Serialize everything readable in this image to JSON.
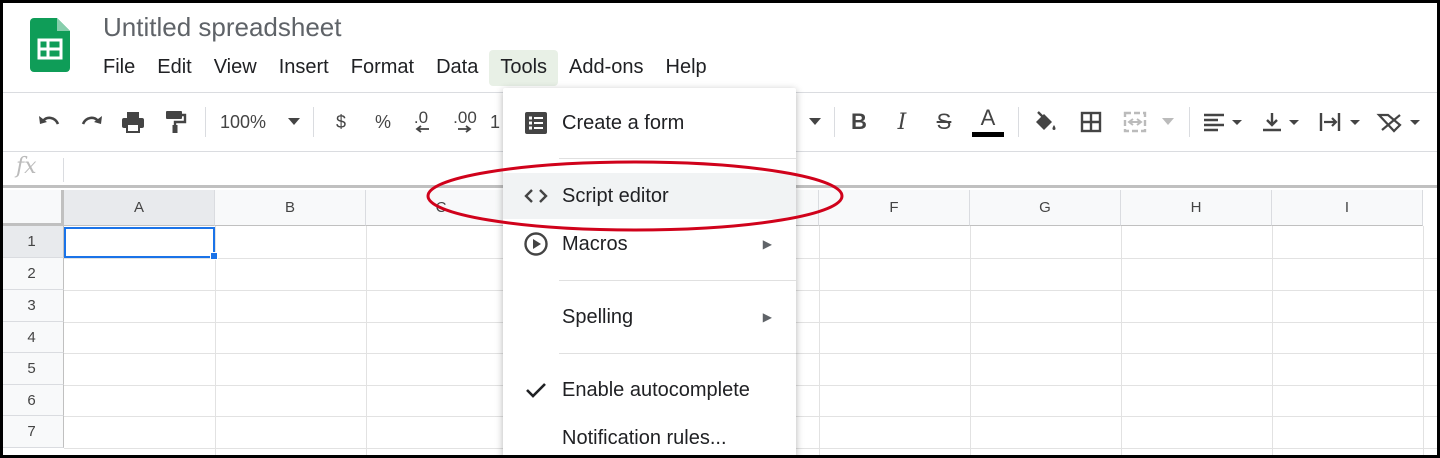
{
  "app": {
    "title": "Untitled spreadsheet",
    "brand_color": "#0f9d58",
    "logo_icon": "sheets-logo-icon"
  },
  "menubar": [
    "File",
    "Edit",
    "View",
    "Insert",
    "Format",
    "Data",
    "Tools",
    "Add-ons",
    "Help"
  ],
  "active_menu": "Tools",
  "toolbar": {
    "zoom": "100%",
    "currency": "$",
    "percent": "%",
    "decrease_decimal": ".0",
    "increase_decimal": ".00",
    "more_formats_partial": "1",
    "bold": "B",
    "italic": "I",
    "strikethrough": "S",
    "text_color": "A",
    "text_color_swatch": "#000000"
  },
  "formula_bar": {
    "fx_label": "fx",
    "value": ""
  },
  "grid": {
    "columns": [
      "A",
      "B",
      "C",
      "",
      "",
      "F",
      "G",
      "H",
      "I"
    ],
    "rows": [
      "1",
      "2",
      "3",
      "4",
      "5",
      "6",
      "7"
    ],
    "selected_cell": "A1",
    "selection_color": "#1a73e8"
  },
  "tools_menu": {
    "items": [
      {
        "label": "Create a form",
        "icon": "form-icon",
        "submenu": false
      },
      {
        "label": "Script editor",
        "icon": "code-icon",
        "submenu": false,
        "hovered": true
      },
      {
        "label": "Macros",
        "icon": "play-circle-icon",
        "submenu": true
      },
      {
        "label": "Spelling",
        "icon": "",
        "submenu": true
      },
      {
        "label": "Enable autocomplete",
        "icon": "checkmark-icon",
        "submenu": false,
        "checked": true
      },
      {
        "label": "Notification rules...",
        "icon": "",
        "submenu": false
      }
    ],
    "submenu_arrow": "▶"
  },
  "annotation": {
    "shape": "ellipse",
    "target": "Script editor",
    "color": "#d0021b"
  }
}
